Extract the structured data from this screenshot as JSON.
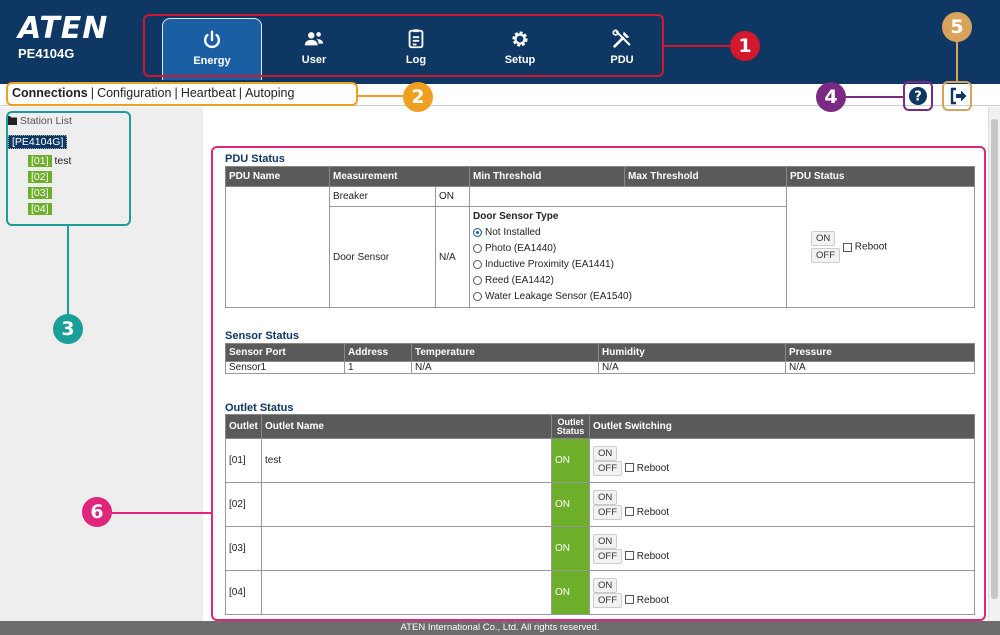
{
  "brand": {
    "logo": "ATEN",
    "model": "PE4104G"
  },
  "nav_tabs": [
    {
      "label": "Energy",
      "icon": "power-icon",
      "active": true
    },
    {
      "label": "User",
      "icon": "users-icon"
    },
    {
      "label": "Log",
      "icon": "log-icon"
    },
    {
      "label": "Setup",
      "icon": "gear-icon"
    },
    {
      "label": "PDU",
      "icon": "tools-icon"
    }
  ],
  "subnav": {
    "items": [
      "Connections",
      "Configuration",
      "Heartbeat",
      "Autoping"
    ],
    "separator": "|"
  },
  "sidebar": {
    "title": "Station List",
    "root": "[PE4104G]",
    "ports": [
      {
        "id": "[01]",
        "name": "test"
      },
      {
        "id": "[02]",
        "name": ""
      },
      {
        "id": "[03]",
        "name": ""
      },
      {
        "id": "[04]",
        "name": ""
      }
    ]
  },
  "pdu_status": {
    "title": "PDU Status",
    "headers": [
      "PDU Name",
      "Measurement",
      "Min Threshold",
      "Max Threshold",
      "PDU Status"
    ],
    "breaker_label": "Breaker",
    "breaker_value": "ON",
    "door_label": "Door Sensor",
    "door_value": "N/A",
    "door_type_title": "Door Sensor Type",
    "door_types": [
      "Not Installed",
      "Photo (EA1440)",
      "Inductive Proximity (EA1441)",
      "Reed (EA1442)",
      "Water Leakage Sensor (EA1540)"
    ],
    "on_label": "ON",
    "off_label": "OFF",
    "reboot_label": "Reboot"
  },
  "sensor_status": {
    "title": "Sensor Status",
    "headers": [
      "Sensor Port",
      "Address",
      "Temperature",
      "Humidity",
      "Pressure"
    ],
    "row": [
      "Sensor1",
      "1",
      "N/A",
      "N/A",
      "N/A"
    ]
  },
  "outlet_status": {
    "title": "Outlet Status",
    "headers": [
      "Outlet",
      "Outlet Name",
      "Outlet Status",
      "Outlet Switching"
    ],
    "rows": [
      {
        "outlet": "[01]",
        "name": "test",
        "status": "ON"
      },
      {
        "outlet": "[02]",
        "name": "",
        "status": "ON"
      },
      {
        "outlet": "[03]",
        "name": "",
        "status": "ON"
      },
      {
        "outlet": "[04]",
        "name": "",
        "status": "ON"
      }
    ],
    "on_label": "ON",
    "off_label": "OFF",
    "reboot_label": "Reboot"
  },
  "footer": "ATEN International Co., Ltd. All rights reserved.",
  "callouts": [
    "1",
    "2",
    "3",
    "4",
    "5",
    "6"
  ],
  "colors": {
    "header_bg": "#0f3763",
    "callout_red": "#d2182d",
    "callout_orange": "#f0a020",
    "callout_teal": "#1a9e9a",
    "callout_purple": "#7a2a82",
    "callout_tan": "#d9a35c",
    "callout_pink": "#e0267a",
    "status_green": "#6dae2b"
  }
}
